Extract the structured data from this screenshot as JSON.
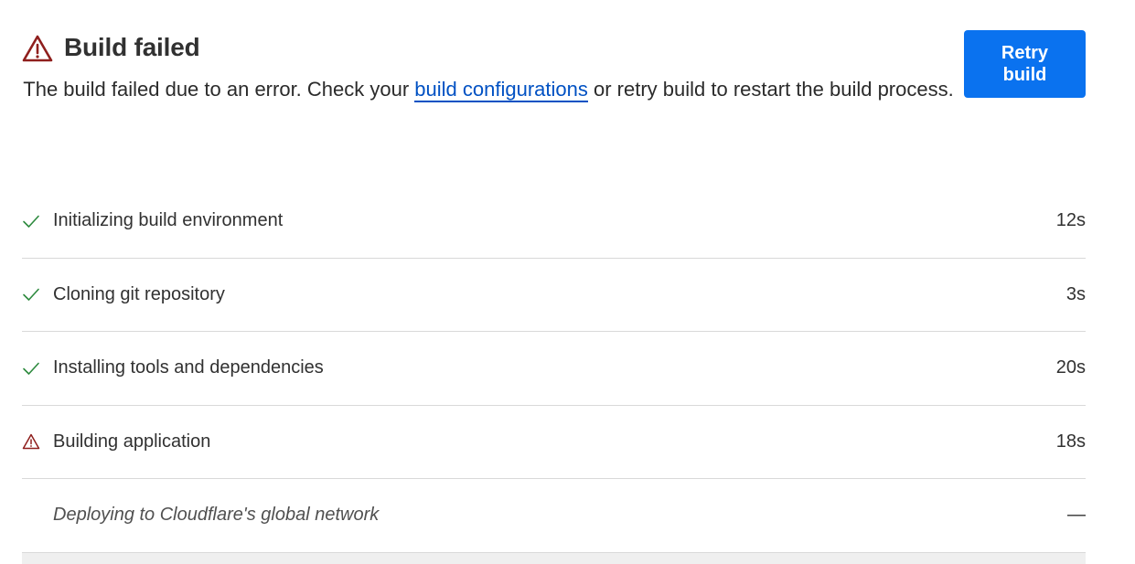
{
  "header": {
    "title": "Build failed",
    "description_before": "The build failed due to an error. Check your ",
    "description_link": "build configurations",
    "description_after": " or retry build to restart the build process."
  },
  "actions": {
    "retry_label": "Retry build"
  },
  "steps": [
    {
      "label": "Initializing build environment",
      "duration": "12s",
      "status": "success",
      "icon": "check-icon"
    },
    {
      "label": "Cloning git repository",
      "duration": "3s",
      "status": "success",
      "icon": "check-icon"
    },
    {
      "label": "Installing tools and dependencies",
      "duration": "20s",
      "status": "success",
      "icon": "check-icon"
    },
    {
      "label": "Building application",
      "duration": "18s",
      "status": "failed",
      "icon": "warning-icon"
    },
    {
      "label": "Deploying to Cloudflare's global network",
      "duration": "—",
      "status": "pending",
      "icon": ""
    }
  ],
  "colors": {
    "error": "#8f1f1d",
    "success": "#2d8a3e",
    "link": "#0051c3",
    "primary": "#0a72ef"
  }
}
